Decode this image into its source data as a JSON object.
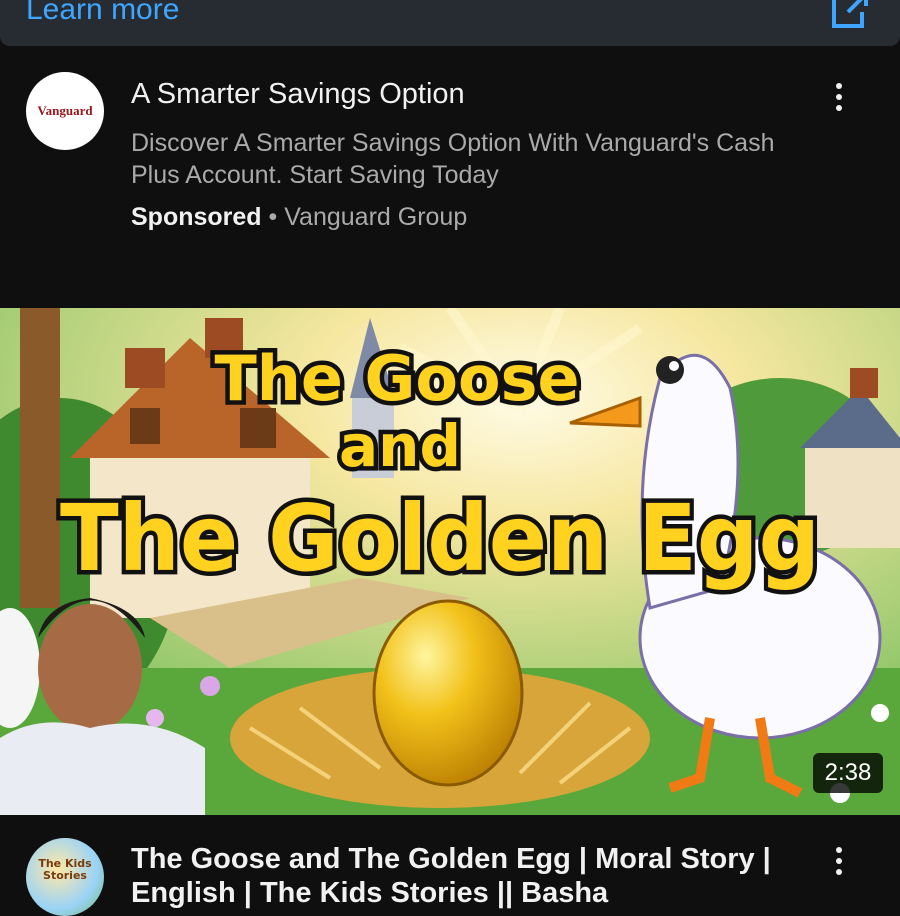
{
  "top_bar": {
    "learn_more": "Learn more"
  },
  "ad": {
    "logo_text": "Vanguard",
    "title": "A Smarter Savings Option",
    "description": "Discover A Smarter Savings Option With Vanguard's Cash Plus Account. Start Saving Today",
    "sponsored_label": "Sponsored",
    "separator": " • ",
    "advertiser": "Vanguard Group"
  },
  "video": {
    "thumbnail_title_line1": "The Goose",
    "thumbnail_title_line2": "and",
    "thumbnail_title_line3": "The Golden Egg",
    "duration": "2:38",
    "title": "The Goose and The Golden Egg | Moral Story | English | The Kids Stories || Basha",
    "channel_avatar_text": "The Kids Stories"
  },
  "colors": {
    "link_blue": "#3ea6ff",
    "background": "#0f0f0f",
    "title_yellow": "#ffd21f"
  },
  "icons": [
    "open-external-icon",
    "more-vert-icon"
  ]
}
